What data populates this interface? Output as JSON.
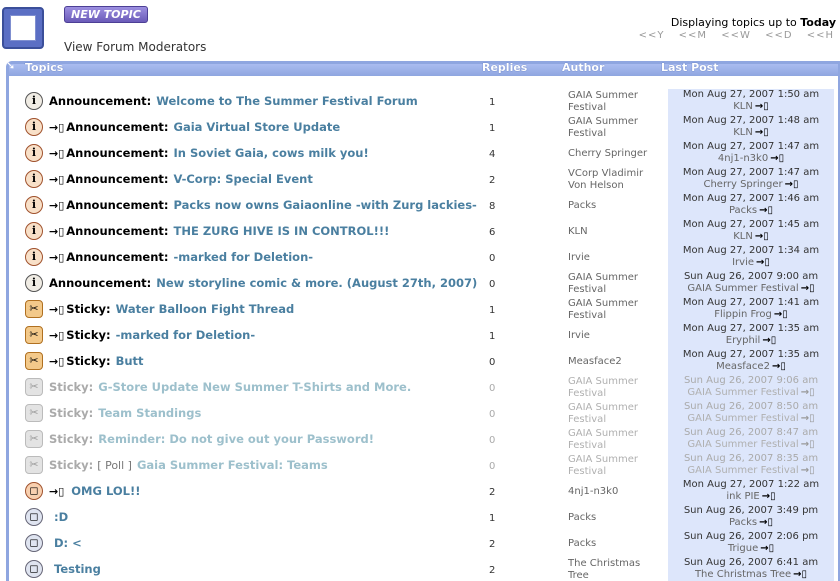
{
  "toolbar": {
    "new_topic_label": "NEW TOPIC",
    "moderators_link": "View Forum Moderators"
  },
  "display": {
    "prefix": "Displaying topics up to",
    "current": "Today"
  },
  "nav": [
    "<<Y",
    "<<M",
    "<<W",
    "<<D",
    "<<H"
  ],
  "headers": {
    "topics": "Topics",
    "replies": "Replies",
    "author": "Author",
    "last_post": "Last Post"
  },
  "newpost_icon": "→▯",
  "topics": [
    {
      "icon": "info",
      "newpost": false,
      "label": "Announcement:",
      "title": "Welcome to The Summer Festival Forum",
      "replies": "1",
      "author": "GAIA Summer Festival",
      "lp_date": "Mon Aug 27, 2007 1:50 am",
      "lp_user": "KLN",
      "faded": false
    },
    {
      "icon": "info-new",
      "newpost": true,
      "label": "Announcement:",
      "title": "Gaia Virtual Store Update",
      "replies": "1",
      "author": "GAIA Summer Festival",
      "lp_date": "Mon Aug 27, 2007 1:48 am",
      "lp_user": "KLN",
      "faded": false
    },
    {
      "icon": "info-new",
      "newpost": true,
      "label": "Announcement:",
      "title": "In Soviet Gaia, cows milk you!",
      "replies": "4",
      "author": "Cherry Springer",
      "lp_date": "Mon Aug 27, 2007 1:47 am",
      "lp_user": "4nj1-n3k0",
      "faded": false
    },
    {
      "icon": "info-new",
      "newpost": true,
      "label": "Announcement:",
      "title": "V-Corp: Special Event",
      "replies": "2",
      "author": "VCorp Vladimir Von Helson",
      "lp_date": "Mon Aug 27, 2007 1:47 am",
      "lp_user": "Cherry Springer",
      "faded": false
    },
    {
      "icon": "info-new",
      "newpost": true,
      "label": "Announcement:",
      "title": "Packs now owns Gaiaonline -with Zurg lackies-",
      "replies": "8",
      "author": "Packs",
      "lp_date": "Mon Aug 27, 2007 1:46 am",
      "lp_user": "Packs",
      "faded": false
    },
    {
      "icon": "info-new",
      "newpost": true,
      "label": "Announcement:",
      "title": "THE ZURG HIVE IS IN CONTROL!!!",
      "replies": "6",
      "author": "KLN",
      "lp_date": "Mon Aug 27, 2007 1:45 am",
      "lp_user": "KLN",
      "faded": false
    },
    {
      "icon": "info-new",
      "newpost": true,
      "label": "Announcement:",
      "title": "-marked for Deletion-",
      "replies": "0",
      "author": "Irvie",
      "lp_date": "Mon Aug 27, 2007 1:34 am",
      "lp_user": "Irvie",
      "faded": false
    },
    {
      "icon": "info",
      "newpost": false,
      "label": "Announcement:",
      "title": "New storyline comic & more. (August 27th, 2007)",
      "replies": "0",
      "author": "GAIA Summer Festival",
      "lp_date": "Sun Aug 26, 2007 9:00 am",
      "lp_user": "GAIA Summer Festival",
      "faded": false
    },
    {
      "icon": "sticky",
      "newpost": true,
      "label": "Sticky:",
      "title": "Water Balloon Fight Thread",
      "replies": "1",
      "author": "GAIA Summer Festival",
      "lp_date": "Mon Aug 27, 2007 1:41 am",
      "lp_user": "Flippin Frog",
      "faded": false
    },
    {
      "icon": "sticky",
      "newpost": true,
      "label": "Sticky:",
      "title": "-marked for Deletion-",
      "replies": "1",
      "author": "Irvie",
      "lp_date": "Mon Aug 27, 2007 1:35 am",
      "lp_user": "Eryphil",
      "faded": false
    },
    {
      "icon": "sticky",
      "newpost": true,
      "label": "Sticky:",
      "title": "Butt",
      "replies": "0",
      "author": "Measface2",
      "lp_date": "Mon Aug 27, 2007 1:35 am",
      "lp_user": "Measface2",
      "faded": false
    },
    {
      "icon": "sticky-old",
      "newpost": false,
      "label": "Sticky:",
      "title": "G-Store Update New Summer T-Shirts and More.",
      "replies": "0",
      "author": "GAIA Summer Festival",
      "lp_date": "Sun Aug 26, 2007 9:06 am",
      "lp_user": "GAIA Summer Festival",
      "faded": true
    },
    {
      "icon": "sticky-old",
      "newpost": false,
      "label": "Sticky:",
      "title": "Team Standings",
      "replies": "0",
      "author": "GAIA Summer Festival",
      "lp_date": "Sun Aug 26, 2007 8:50 am",
      "lp_user": "GAIA Summer Festival",
      "faded": true
    },
    {
      "icon": "sticky-old",
      "newpost": false,
      "label": "Sticky:",
      "title": "Reminder: Do not give out your Password!",
      "replies": "0",
      "author": "GAIA Summer Festival",
      "lp_date": "Sun Aug 26, 2007 8:47 am",
      "lp_user": "GAIA Summer Festival",
      "faded": true
    },
    {
      "icon": "sticky-old",
      "newpost": false,
      "label": "Sticky: [ Poll ]",
      "title": "Gaia Summer Festival: Teams",
      "replies": "0",
      "author": "GAIA Summer Festival",
      "lp_date": "Sun Aug 26, 2007 8:35 am",
      "lp_user": "GAIA Summer Festival",
      "faded": true
    },
    {
      "icon": "normal-hot",
      "newpost": true,
      "label": "",
      "title": "OMG LOL!!",
      "replies": "2",
      "author": "4nj1-n3k0",
      "lp_date": "Mon Aug 27, 2007 1:22 am",
      "lp_user": "ink PIE",
      "faded": false
    },
    {
      "icon": "normal",
      "newpost": false,
      "label": "",
      "title": ":D",
      "replies": "1",
      "author": "Packs",
      "lp_date": "Sun Aug 26, 2007 3:49 pm",
      "lp_user": "Packs",
      "faded": false
    },
    {
      "icon": "normal",
      "newpost": false,
      "label": "",
      "title": "D: <",
      "replies": "2",
      "author": "Packs",
      "lp_date": "Sun Aug 26, 2007 2:06 pm",
      "lp_user": "Trigue",
      "faded": false
    },
    {
      "icon": "normal",
      "newpost": false,
      "label": "",
      "title": "Testing",
      "replies": "2",
      "author": "The Christmas Tree",
      "lp_date": "Sun Aug 26, 2007 6:41 am",
      "lp_user": "The Christmas Tree",
      "faded": false
    }
  ]
}
